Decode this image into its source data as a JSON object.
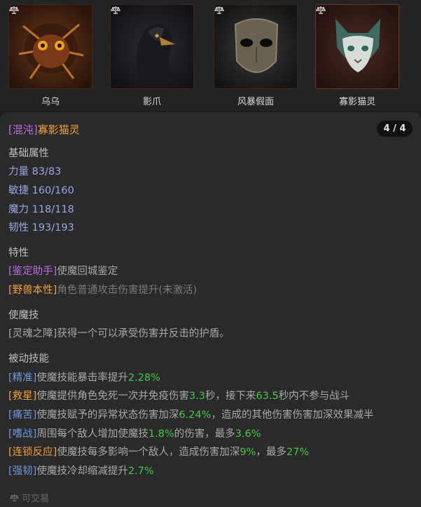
{
  "cards": [
    {
      "name": "乌乌"
    },
    {
      "name": "影爪"
    },
    {
      "name": "风暴假面"
    },
    {
      "name": "寡影猫灵"
    }
  ],
  "item": {
    "prefix": "[混沌]",
    "name": "寡影猫灵",
    "page": "4 / 4"
  },
  "base": {
    "header": "基础属性",
    "stats": [
      {
        "label": "力量",
        "value": "83/83"
      },
      {
        "label": "敏捷",
        "value": "160/160"
      },
      {
        "label": "魔力",
        "value": "118/118"
      },
      {
        "label": "韧性",
        "value": "193/193"
      }
    ]
  },
  "traits": {
    "header": "特性",
    "t1_tag": "[鉴定助手]",
    "t1_text": "使魔回城鉴定",
    "t2_tag": "[野兽本性]",
    "t2_text": "角色普通攻击伤害提升(未激活)"
  },
  "skill": {
    "header": "使魔技",
    "text": "[灵魂之障]获得一个可以承受伤害并反击的护盾。"
  },
  "passive": {
    "header": "被动技能",
    "p1_tag": "[精准]",
    "p1_a": "使魔技能暴击率提升",
    "p1_v": "2.28%",
    "p2_tag": "[救星]",
    "p2_a": "使魔提供角色免死一次并免疫伤害",
    "p2_v1": "3.3",
    "p2_b": "秒，接下来",
    "p2_v2": "63.5",
    "p2_c": "秒内不参与战斗",
    "p3_tag": "[痛苦]",
    "p3_a": "使魔技赋予的异常状态伤害加深",
    "p3_v": "6.24%",
    "p3_b": "，造成的其他伤害伤害加深效果减半",
    "p4_tag": "[嗜战]",
    "p4_a": "周围每个敌人增加使魔技",
    "p4_v1": "1.8%",
    "p4_b": "的伤害，最多",
    "p4_v2": "3.6%",
    "p5_tag": "[连锁反应]",
    "p5_a": "使魔技每多影响一个敌人，造成伤害加深",
    "p5_v1": "9%",
    "p5_b": "，最多",
    "p5_v2": "27%",
    "p6_tag": "[强韧]",
    "p6_a": "使魔技冷却缩减提升",
    "p6_v": "2.7%"
  },
  "footer": {
    "icon": "scale-icon",
    "text": "可交易"
  }
}
